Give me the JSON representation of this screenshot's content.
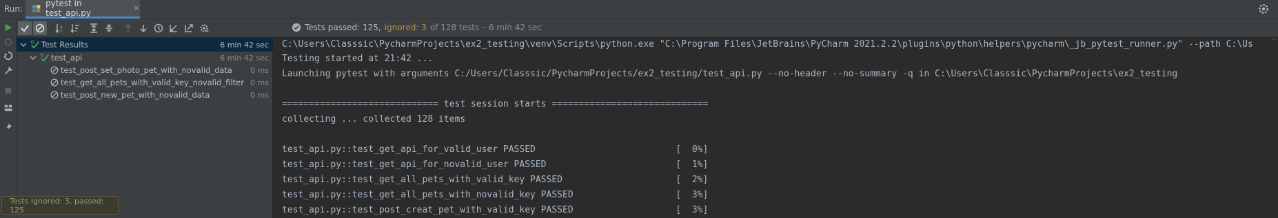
{
  "window": {
    "run_label": "Run:",
    "tab_title": "pytest in test_api.py",
    "tab_close": "✕"
  },
  "status": {
    "passed": "Tests passed: 125,",
    "ignored": "ignored: 3",
    "rest": "of 128 tests – 6 min 42 sec"
  },
  "tree": {
    "root": {
      "label": "Test Results",
      "duration": "6 min 42 sec"
    },
    "suite": {
      "label": "test_api",
      "duration": "6 min 42 sec"
    },
    "tests": [
      {
        "label": "test_post_set_photo_pet_with_novalid_data",
        "duration": "0 ms"
      },
      {
        "label": "test_get_all_pets_with_valid_key_novalid_filter",
        "duration": "0 ms"
      },
      {
        "label": "test_post_new_pet_with_novalid_data",
        "duration": "0 ms"
      }
    ]
  },
  "console": {
    "lines": [
      "C:\\Users\\Classsic\\PycharmProjects\\ex2_testing\\venv\\Scripts\\python.exe \"C:\\Program Files\\JetBrains\\PyCharm 2021.2.2\\plugins\\python\\helpers\\pycharm\\_jb_pytest_runner.py\" --path C:\\Us",
      "Testing started at 21:42 ...",
      "Launching pytest with arguments C:/Users/Classsic/PycharmProjects/ex2_testing/test_api.py --no-header --no-summary -q in C:\\Users\\Classsic\\PycharmProjects\\ex2_testing",
      "",
      "============================= test session starts =============================",
      "collecting ... collected 128 items",
      "",
      "test_api.py::test_get_api_for_valid_user PASSED                          [  0%]",
      "test_api.py::test_get_api_for_novalid_user PASSED                        [  1%]",
      "test_api.py::test_get_all_pets_with_valid_key PASSED                     [  2%]",
      "test_api.py::test_get_all_pets_with_novalid_key PASSED                   [  3%]",
      "test_api.py::test_post_creat_pet_with_valid_key PASSED                   [  3%]"
    ]
  },
  "tooltip": "Tests ignored: 3, passed: 125",
  "colors": {
    "accent": "#4a88c7",
    "passed_green": "#499c54",
    "ignored_orange": "#c28e3e",
    "selection": "#0d293e"
  }
}
